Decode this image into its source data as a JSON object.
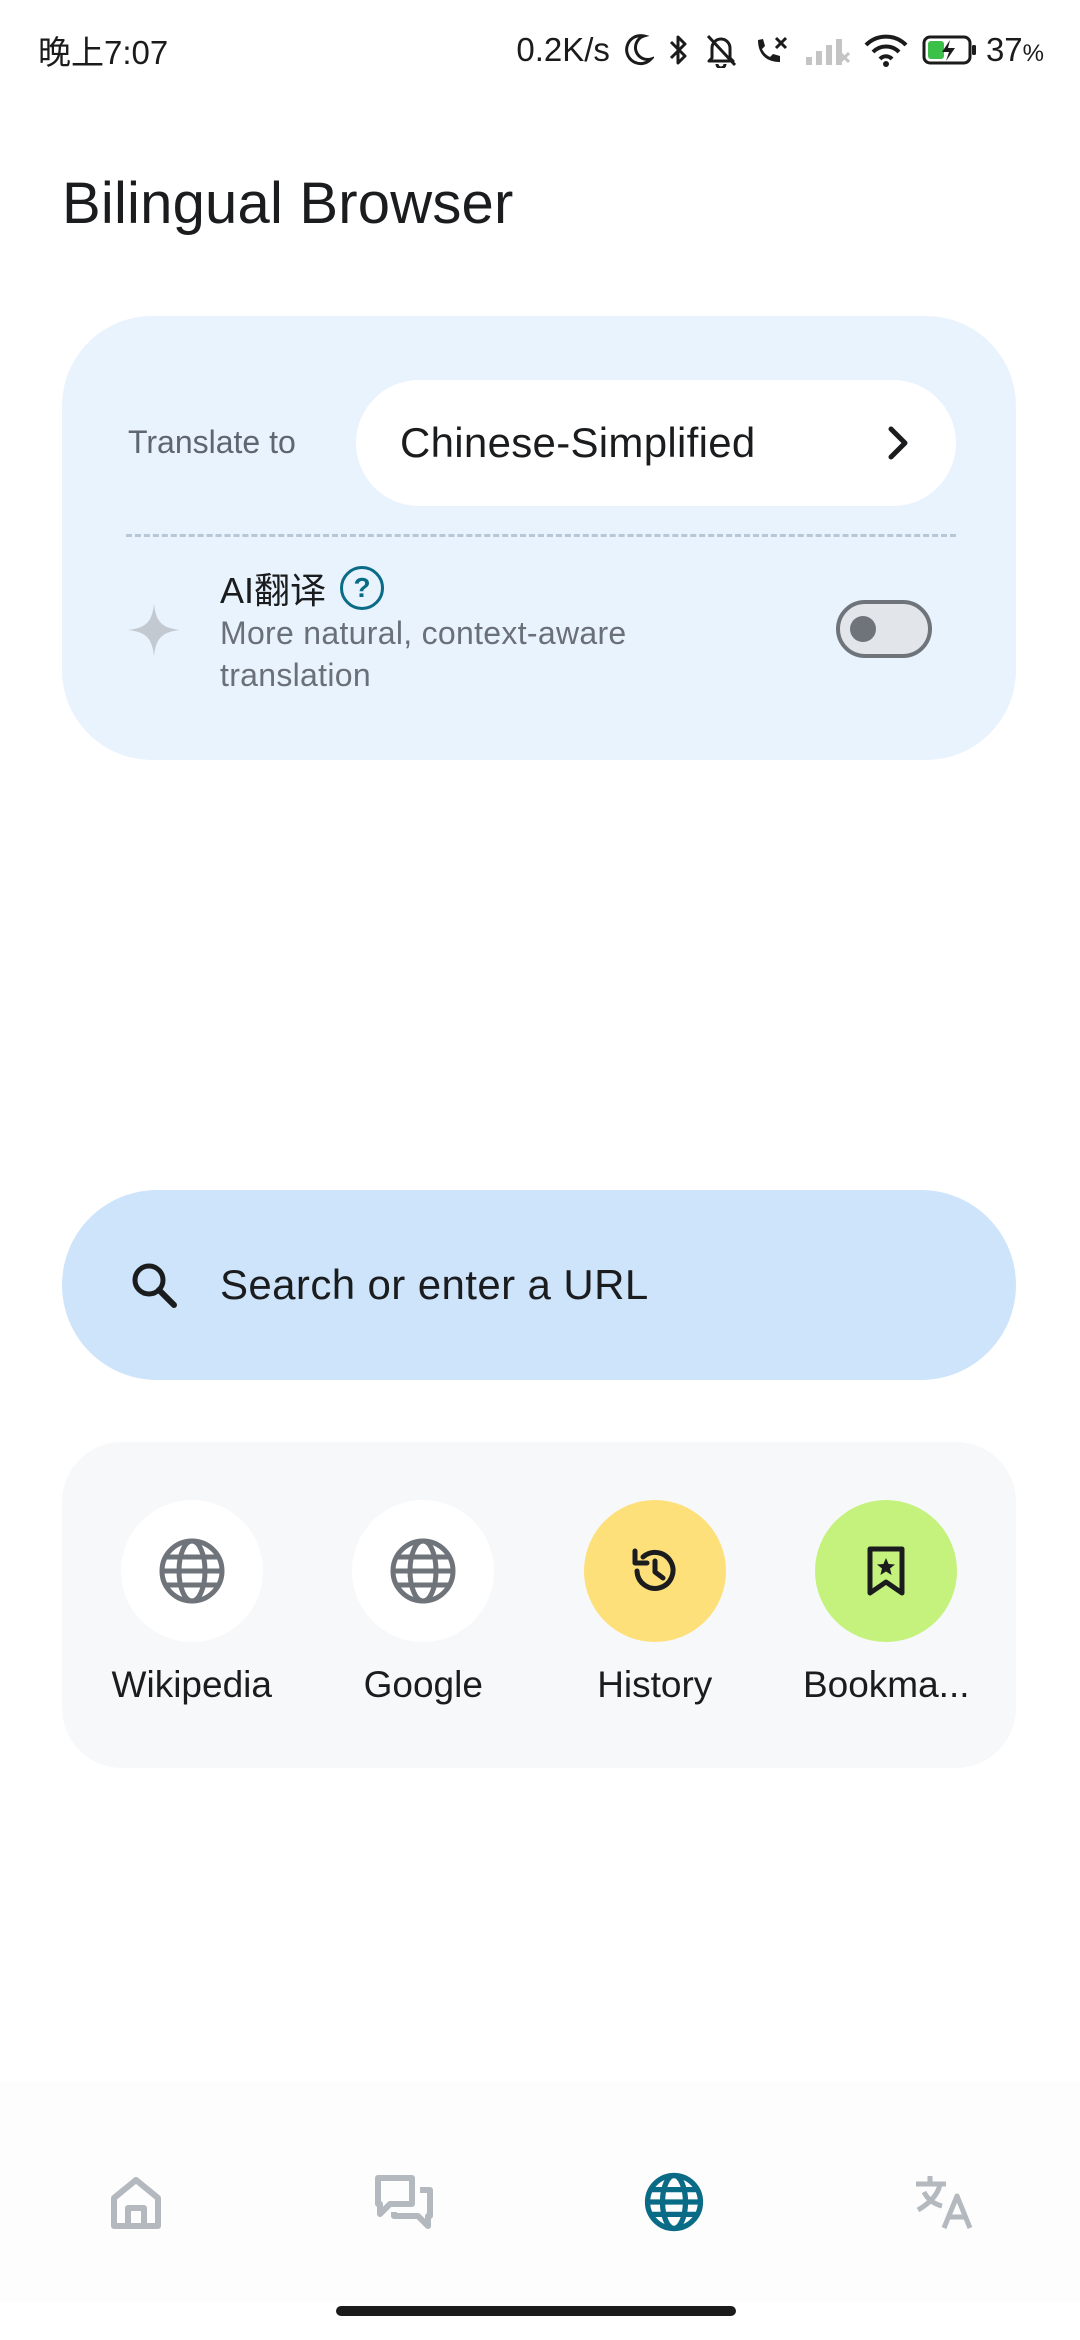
{
  "status_bar": {
    "time": "晚上7:07",
    "net_speed": "0.2K/s",
    "battery": "37",
    "battery_unit": "%"
  },
  "app": {
    "title": "Bilingual Browser"
  },
  "translate": {
    "label": "Translate to",
    "language": "Chinese-Simplified",
    "ai_title": "AI翻译",
    "help_glyph": "?",
    "ai_desc": "More natural, context-aware translation",
    "ai_enabled": false
  },
  "search": {
    "placeholder": "Search or enter a URL"
  },
  "shortcuts": [
    {
      "label": "Wikipedia",
      "icon": "globe-icon",
      "bg": "#ffffff"
    },
    {
      "label": "Google",
      "icon": "globe-icon",
      "bg": "#ffffff"
    },
    {
      "label": "History",
      "icon": "history-icon",
      "bg": "#fde07a"
    },
    {
      "label": "Bookma...",
      "icon": "bookmark-icon",
      "bg": "#c5f27c"
    }
  ],
  "bottom_nav": {
    "items": [
      "home-icon",
      "chat-icon",
      "globe-icon",
      "translate-icon"
    ],
    "active": "globe-icon"
  },
  "colors": {
    "accent": "#0a6b86",
    "card_bg": "#e8f3fd",
    "search_bg": "#cde4fb",
    "inactive_icon": "#b4b9bf"
  }
}
